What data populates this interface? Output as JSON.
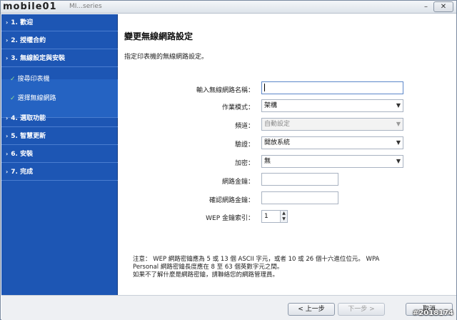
{
  "window": {
    "title": "MI...series",
    "logo_text": "mobile01",
    "minimize_glyph": "–",
    "close_glyph": "✕"
  },
  "sidebar": {
    "steps": [
      {
        "label": "1. 歡迎"
      },
      {
        "label": "2. 授權合約"
      },
      {
        "label": "3. 無線設定與安裝"
      },
      {
        "label": "4. 選取功能"
      },
      {
        "label": "5. 智慧更新"
      },
      {
        "label": "6. 安裝"
      },
      {
        "label": "7. 完成"
      }
    ],
    "substeps": [
      {
        "label": "搜尋印表機"
      },
      {
        "label": "選擇無線網路"
      }
    ],
    "chevron_glyph": "›",
    "check_glyph": "✓"
  },
  "main": {
    "heading": "變更無線網路設定",
    "subtitle": "指定印表機的無線網路設定。",
    "form": {
      "ssid_label": "輸入無線網路名稱：",
      "ssid_value": "",
      "mode_label": "作業模式：",
      "mode_value": "架構",
      "channel_label": "頻道：",
      "channel_value": "自動設定",
      "auth_label": "驗證：",
      "auth_value": "開放系統",
      "encryption_label": "加密：",
      "encryption_value": "無",
      "key_label": "網路金鑰：",
      "key_value": "",
      "confirm_key_label": "確認網路金鑰：",
      "confirm_key_value": "",
      "wep_index_label": "WEP 金鑰索引：",
      "wep_index_value": "1"
    },
    "note_lines": [
      "注意： WEP 網路密鑰應為 5 或 13 個 ASCII 字元，或者 10 或 26 個十六進位位元。 WPA",
      "Personal 網路密鑰長度應在 8 至 63 個英數字元之間。",
      "如果不了解什麼是網路密鑰，請聯絡您的網路管理員。"
    ]
  },
  "buttons": {
    "back": "< 上一步",
    "next": "下一步 >",
    "cancel": "取消"
  },
  "watermark": "#2018174"
}
